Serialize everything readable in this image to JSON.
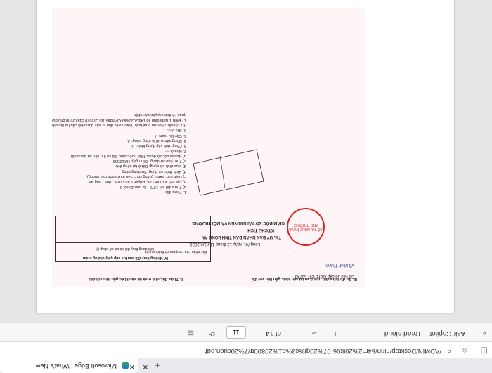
{
  "browser": {
    "tab_title": "Microsoft Edge | What's New",
    "url": "/ADMIN/Desktop/hinh/64m2%20lk06-07%20gi%c3%a1%20800tr/7%20cuon.pdf"
  },
  "pdf_toolbar": {
    "current_page": "11",
    "page_total": "of 14",
    "zoom_minus": "−",
    "zoom_plus": "+",
    "read_aloud": "Read aloud",
    "ask_copilot": "Ask Copilot"
  },
  "document": {
    "section_2_title": "II. Thửa đất, nhà ở và tài sản khác gắn liền với đất",
    "section_3_title": "III. Sơ đồ thửa đất, nhà ở và tài sản khác gắn liền với đất",
    "section_4_title": "IV. Những thay đổi sau khi cấp giấy chứng nhận",
    "land_info": [
      "1. Thửa đất:",
      "a) Thửa đất số: 1970   ; tờ bản đồ số: 5",
      "b) Địa chỉ: Xã Tân Lân, Huyện Cần Đước, Tỉnh Long An",
      "c) Diện tích: 64m², (bằng chữ: Sáu mươi bốn mét vuông);",
      "d) Hình thức sử dụng: Sử dụng riêng",
      "đ) Mục đích sử dụng: Đất ở tại nông thôn",
      "e) Thời hạn sử dụng: Đến ngày 16/5/2069",
      "g) Nguồn gốc sử dụng: Nhà nước giao đất có thu tiền sử dụng đất",
      "2. Nhà ở: -/-",
      "3. Công trình xây dựng khác: -/-",
      "4. Rừng sản xuất là rừng trồng: -/-",
      "5. Cây lâu năm: -/-",
      "6. Ghi chú:",
      "Khi chuyển nhượng phải hoàn thành việc đầu tư xây dựng kết cấu hạ tầng theo khoản",
      "17 Điều 1 Nghị định số 148/2020/NĐ-CP ngày 18/12/2020 của Chính phủ được cơ",
      "quan có thẩm quyền xác nhận."
    ],
    "sign_date": "Long An, ngày 12 tháng 11 năm 2021",
    "sign_org_1": "TM. ỦY BAN NHÂN DÂN TỈNH LONG AN",
    "sign_org_2": "KT.CHỦ TỊCH",
    "sign_org_3": "GIÁM ĐỐC SỞ TÀI NGUYÊN VÀ MÔI TRƯỜNG",
    "stamp_text": "SỞ TÀI NGUYÊN VÀ MÔI TRƯỜNG",
    "signer_name": "Võ Minh Thành",
    "register_no": "Số vào sổ cấp GCN: CT- 53743",
    "table_col1": "Nội dung thay đổi và cơ sở pháp lý",
    "table_col2": "Xác nhận của cơ quan có thẩm quyền"
  }
}
